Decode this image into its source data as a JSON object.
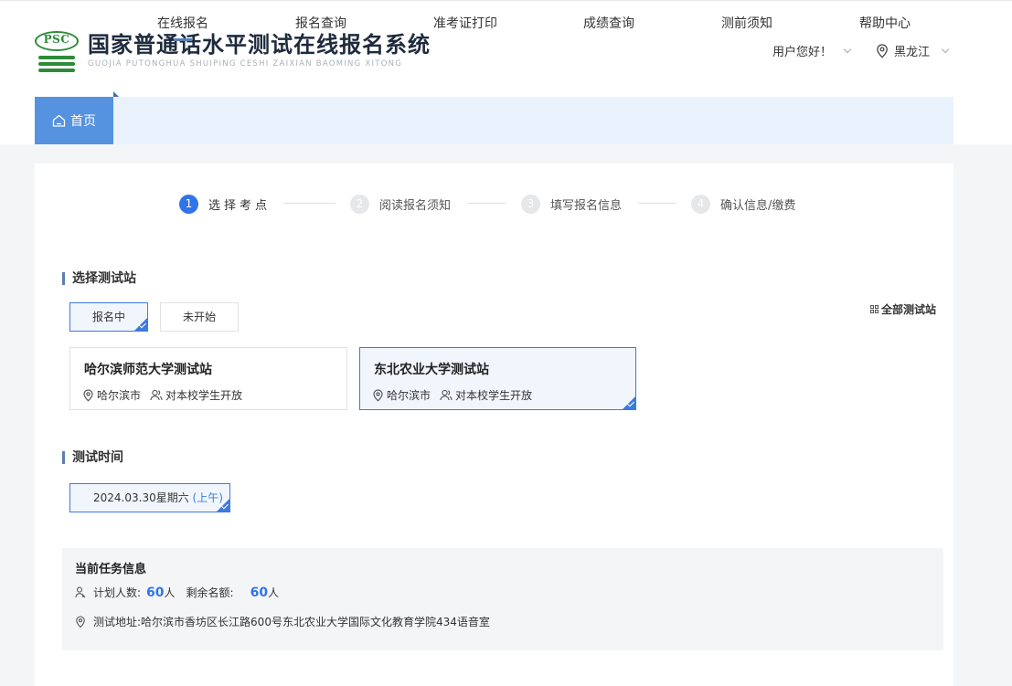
{
  "header": {
    "logo_mark_text": "PSC",
    "title_cn": "国家普通话水平测试在线报名系统",
    "title_en": "GUOJIA PUTONGHUA SHUIPING CESHI ZAIXIAN BAOMING XITONG",
    "greeting": "用户您好！",
    "region": "黑龙江"
  },
  "nav": {
    "home": "首页",
    "items": [
      "在线报名",
      "报名查询",
      "准考证打印",
      "成绩查询",
      "测前须知",
      "帮助中心"
    ],
    "active": "在线报名"
  },
  "steps": [
    {
      "num": "1",
      "label": "选择考点"
    },
    {
      "num": "2",
      "label": "阅读报名须知"
    },
    {
      "num": "3",
      "label": "填写报名信息"
    },
    {
      "num": "4",
      "label": "确认信息/缴费"
    }
  ],
  "select_site": {
    "title": "选择测试站",
    "tabs": [
      "报名中",
      "未开始"
    ],
    "all_sites": "全部测试站",
    "sites": [
      {
        "name": "哈尔滨师范大学测试站",
        "city": "哈尔滨市",
        "open_to": "对本校学生开放"
      },
      {
        "name": "东北农业大学测试站",
        "city": "哈尔滨市",
        "open_to": "对本校学生开放"
      }
    ]
  },
  "test_time": {
    "title": "测试时间",
    "date": "2024.03.30星期六",
    "half": "(上午)"
  },
  "task_info": {
    "title": "当前任务信息",
    "plan_label": "计划人数:",
    "plan_value": "60",
    "plan_unit": "人",
    "remain_label": "剩余名额:",
    "remain_value": "60",
    "remain_unit": "人",
    "address_label": "测试地址:",
    "address": "哈尔滨市香坊区长江路600号东北农业大学国际文化教育学院434语音室"
  },
  "colors": {
    "primary": "#2f74e8",
    "nav_bg": "#eaf3fd",
    "nav_home": "#5592df",
    "logo_green": "#2e8b3a"
  }
}
